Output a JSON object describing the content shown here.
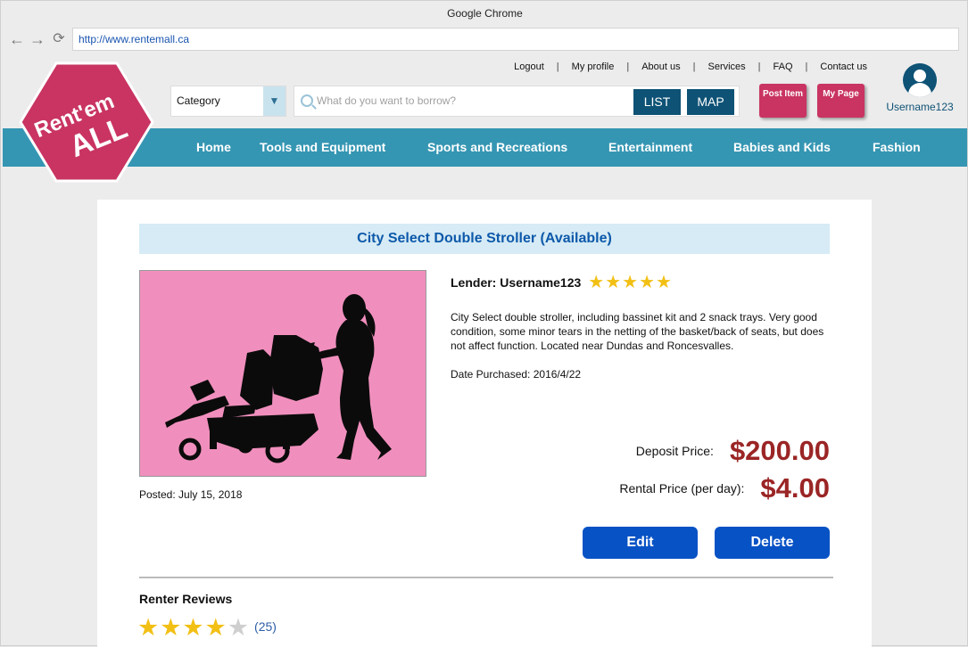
{
  "browser": {
    "title": "Google Chrome",
    "url": "http://www.rentemall.ca",
    "back_icon": "←",
    "forward_icon": "→",
    "reload_icon": "⟳"
  },
  "logo": {
    "line1": "Rent'em",
    "line2": "ALL",
    "color": "#c93462"
  },
  "toplinks": [
    "Logout",
    "My profile",
    "About us",
    "Services",
    "FAQ",
    "Contact us"
  ],
  "search": {
    "category_label": "Category",
    "placeholder": "What do you want to borrow?",
    "list_label": "LIST",
    "map_label": "MAP"
  },
  "actions": {
    "post_item": "Post Item",
    "my_page": "My Page"
  },
  "user": {
    "name": "Username123"
  },
  "menu": [
    "Home",
    "Tools and Equipment",
    "Sports and Recreations",
    "Entertainment",
    "Babies and Kids",
    "Fashion"
  ],
  "listing": {
    "title": "City Select Double Stroller (Available)",
    "lender_label": "Lender: Username123",
    "lender_stars": "★★★★★",
    "description": "City Select double stroller, including bassinet kit and 2 snack trays. Very good condition, some minor tears in the netting of the basket/back of seats, but does not affect function. Located near Dundas and Roncesvalles.",
    "date_purchased": "Date Purchased: 2016/4/22",
    "posted": "Posted: July 15, 2018",
    "deposit_label": "Deposit Price:",
    "deposit_value": "$200.00",
    "rental_label": "Rental Price (per day):",
    "rental_value": "$4.00",
    "edit_label": "Edit",
    "delete_label": "Delete"
  },
  "reviews": {
    "title": "Renter Reviews",
    "stars_filled": "★★★★",
    "stars_empty": "★",
    "count": "(25)"
  },
  "colors": {
    "brand_pink": "#c93462",
    "menu_teal": "#3596b3",
    "dark_blue": "#0e5275",
    "action_blue": "#0752c5",
    "price_red": "#9b2525"
  }
}
